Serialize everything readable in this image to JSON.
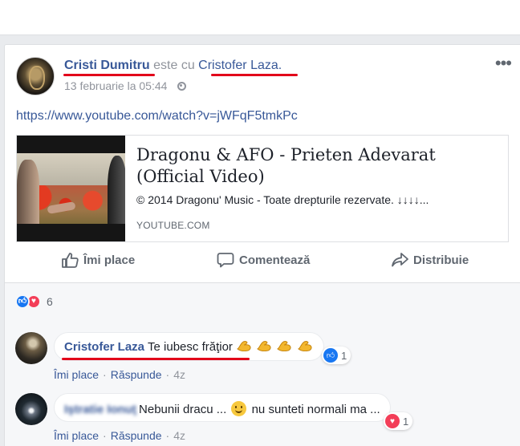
{
  "post": {
    "author": "Cristi Dumitru",
    "with_text": "este cu",
    "tagged": "Cristofer Laza",
    "period": ".",
    "timestamp": "13 februarie la 05:44",
    "link_text": "https://www.youtube.com/watch?v=jWFqF5tmkPc",
    "preview": {
      "title": "Dragonu & AFO - Prieten Adevarat (Official Video)",
      "description": "© 2014 Dragonu' Music - Toate drepturile rezervate. ↓↓↓↓...",
      "source": "YOUTUBE.COM"
    },
    "actions": {
      "like": "Îmi place",
      "comment": "Comentează",
      "share": "Distribuie"
    },
    "reactions": {
      "count": "6"
    }
  },
  "comments": [
    {
      "author": "Cristofer Laza",
      "text": "Te iubesc frăţior",
      "reaction_count": "1",
      "like": "Îmi place",
      "reply": "Răspunde",
      "time": "4z"
    },
    {
      "author": "Iştratie Ionuţ",
      "text_before": "Nebunii dracu ...",
      "text_after": "nu sunteti normali ma ...",
      "reaction_count": "1",
      "like": "Îmi place",
      "reply": "Răspunde",
      "time": "4z"
    }
  ],
  "colors": {
    "link": "#385898",
    "annotation_underline": "#e2001a",
    "like_blue": "#1877f2",
    "love_red": "#f33e58"
  }
}
